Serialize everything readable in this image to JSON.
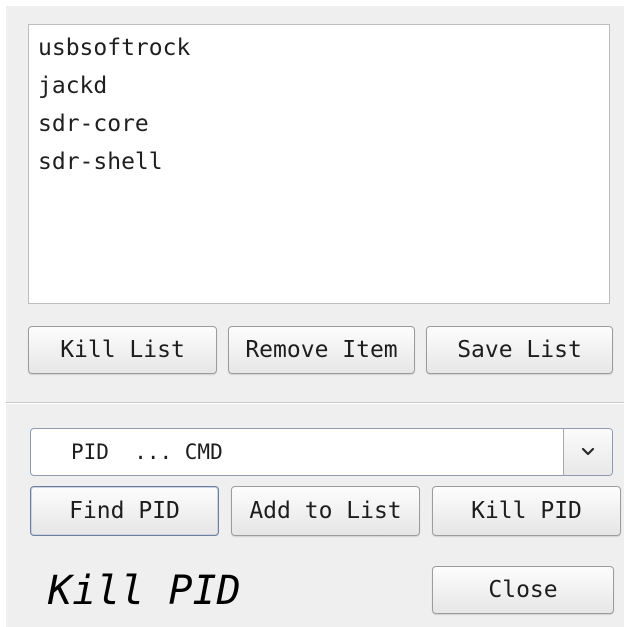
{
  "process_list": {
    "items": [
      "usbsoftrock",
      "jackd",
      "sdr-core",
      "sdr-shell"
    ]
  },
  "list_buttons": {
    "kill_list": "Kill List",
    "remove_item": "Remove Item",
    "save_list": "Save List"
  },
  "process_select": {
    "selected_value": "PID  ... CMD",
    "icon": "chevron-down-icon"
  },
  "pid_buttons": {
    "find_pid": "Find PID",
    "add_to_list": "Add to List",
    "kill_pid": "Kill PID"
  },
  "footer": {
    "title": "Kill PID",
    "close": "Close"
  }
}
